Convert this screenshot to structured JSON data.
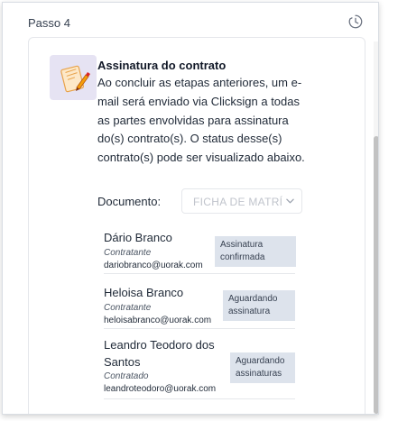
{
  "header": {
    "title": "Passo 4",
    "icon": "clock-icon"
  },
  "step": {
    "title": "Assinatura do contrato",
    "description": "Ao concluir as etapas anteriores, um e-mail será enviado via Clicksign a todas as partes envolvidas para assinatura do(s) contrato(s). O status desse(s) contrato(s) pode ser visualizado abaixo.",
    "icon": "contract-signature-icon"
  },
  "document": {
    "label": "Documento:",
    "selected": "FICHA DE MATRÍ"
  },
  "signers": [
    {
      "name": "Dário Branco",
      "role": "Contratante",
      "email": "dariobranco@uorak.com",
      "status": "Assinatura confirmada"
    },
    {
      "name": "Heloisa Branco",
      "role": "Contratante",
      "email": "heloisabranco@uorak.com",
      "status": "Aguardando assinatura"
    },
    {
      "name": "Leandro Teodoro dos Santos",
      "role": "Contratado",
      "email": "leandroteodoro@uorak.com",
      "status": "Aguardando assinaturas"
    }
  ],
  "colors": {
    "badge_bg": "#dde3ec",
    "icon_bg": "#e6e3f3",
    "accent": "#f59e0b"
  }
}
